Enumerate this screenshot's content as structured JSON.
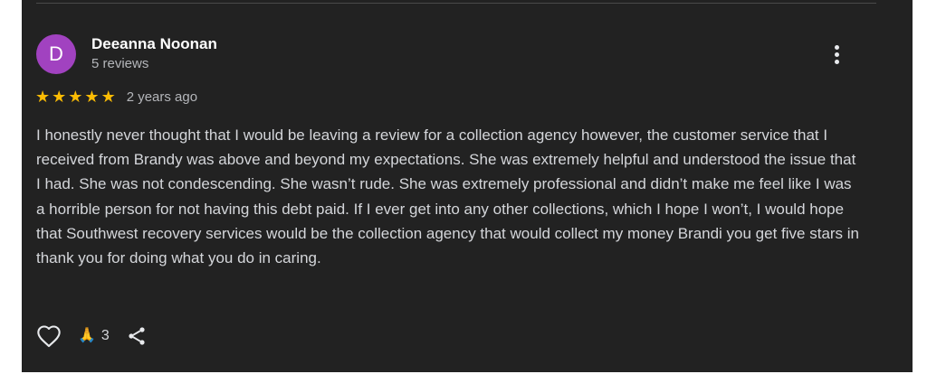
{
  "review": {
    "avatar_letter": "D",
    "avatar_color": "#a142c0",
    "reviewer_name": "Deeanna Noonan",
    "review_count": "5 reviews",
    "rating": 5,
    "rating_max": 5,
    "star_color": "#fbbc04",
    "age": "2 years ago",
    "text": "I honestly never thought that I would be leaving a review for a collection agency however, the customer service that I received from Brandy was above and beyond my expectations. She was extremely helpful and understood the issue that I had. She was not condescending. She wasn’t rude. She was extremely professional and didn’t make me feel like I was a horrible person for not having this debt paid. If I ever get into any other collections, which I hope I won’t, I would hope that Southwest recovery services would be the collection agency that would collect my money Brandi you get five stars in thank you for doing what you do in caring.",
    "reaction_count": "3"
  },
  "icons": {
    "more": "more-vert-icon",
    "like": "heart-outline-icon",
    "reaction": "folded-hands-icon",
    "share": "share-icon"
  },
  "theme": {
    "background": "#222222",
    "text_primary": "#ffffff",
    "text_secondary": "#b4b6ba"
  }
}
